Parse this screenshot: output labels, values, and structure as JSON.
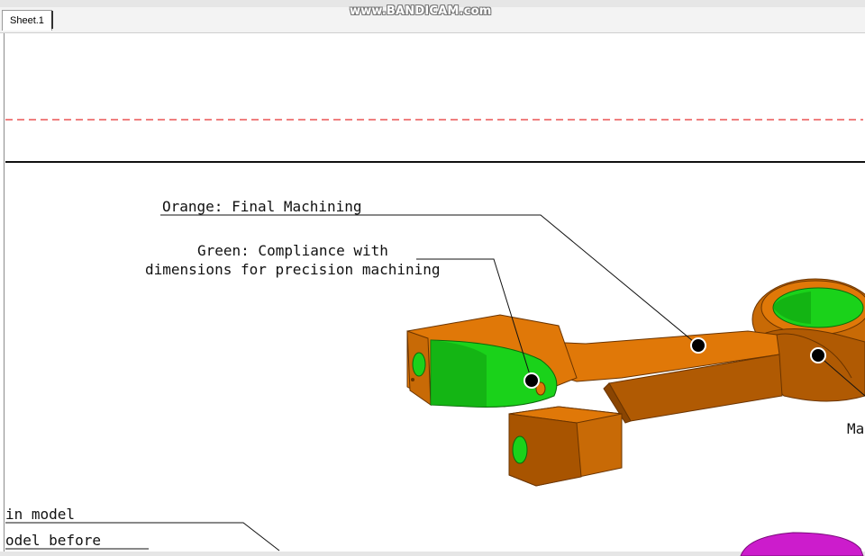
{
  "watermark": "www.BANDICAM.com",
  "tabs": [
    {
      "label": "Sheet.1",
      "active": true
    }
  ],
  "annotations": {
    "orange": "Orange: Final Machining",
    "green_line1": "Green: Compliance with",
    "green_line2": "dimensions for precision machining",
    "right_partial": "Ma",
    "left_partial1": "in model",
    "left_partial2": "odel before"
  },
  "colors": {
    "orange_face": "#e07808",
    "orange_dark": "#a85400",
    "green_face": "#1ad21a",
    "magenta": "#cc1ccc",
    "dashed_line": "#e63333"
  }
}
